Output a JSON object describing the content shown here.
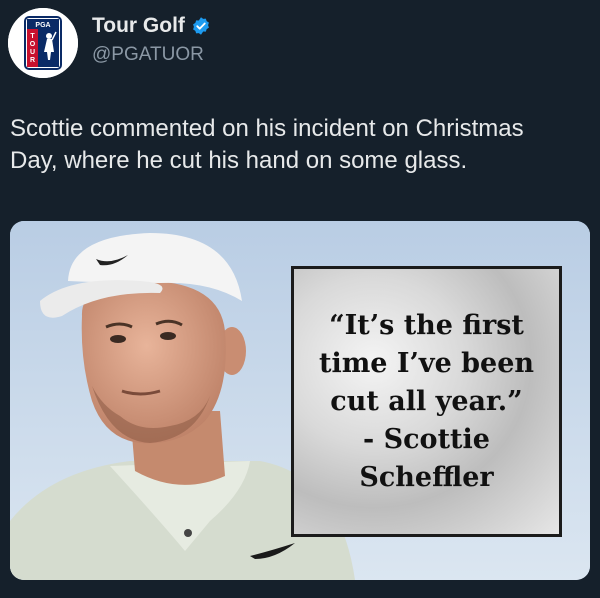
{
  "author": {
    "display_name": "Tour Golf",
    "handle": "@PGATUOR",
    "verified": true,
    "avatar_logo_text": "PGA TOUR",
    "avatar_icon": "pga-tour-logo-icon",
    "verified_icon": "verified-badge-icon"
  },
  "tweet": {
    "text_lines": [
      "Scottie commented on his incident on Christmas",
      "Day, where he cut his hand on some glass."
    ]
  },
  "media": {
    "alt_subject": "photo-of-golfer-in-white-cap",
    "quote_lines": [
      "“It’s the first",
      "time I’ve been",
      "cut all year.”",
      "- Scottie",
      "Scheffler"
    ]
  },
  "colors": {
    "background": "#15202b",
    "text": "#e7e9ea",
    "secondary_text": "#8b98a5",
    "verified": "#1d9bf0"
  }
}
